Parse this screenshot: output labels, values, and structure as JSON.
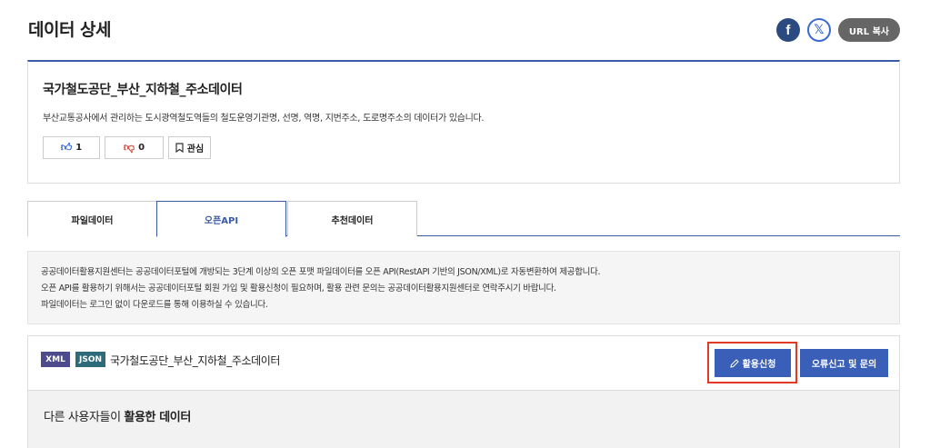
{
  "page": {
    "title": "데이터 상세"
  },
  "share": {
    "facebook_icon": "facebook-icon",
    "x_icon": "x-icon",
    "url_copy_label": "URL 복사"
  },
  "summary": {
    "title": "국가철도공단_부산_지하철_주소데이터",
    "description": "부산교통공사에서 관리하는 도시광역철도역들의 철도운영기관명, 선명, 역명, 지번주소, 도로명주소의 데이터가 있습니다.",
    "like_count": "1",
    "dislike_count": "0",
    "favorite_label": "관심"
  },
  "tabs": [
    {
      "label": "파일데이터",
      "active": false
    },
    {
      "label": "오픈API",
      "active": true
    },
    {
      "label": "추천데이터",
      "active": false
    }
  ],
  "notice": {
    "lines": [
      "공공데이터활용지원센터는 공공데이터포털에 개방되는 3단계 이상의 오픈 포맷 파일데이터를 오픈 API(RestAPI 기반의 JSON/XML)로 자동변환하여 제공합니다.",
      "오픈 API를 활용하기 위해서는 공공데이터포털 회원 가입 및 활용신청이 필요하며, 활용 관련 문의는 공공데이터활용지원센터로 연락주시기 바랍니다.",
      "파일데이터는 로그인 없이 다운로드를 통해 이용하실 수 있습니다."
    ]
  },
  "api": {
    "badges": [
      "XML",
      "JSON"
    ],
    "name": "국가철도공단_부산_지하철_주소데이터",
    "apply_label": "활용신청",
    "report_label": "오류신고 및 문의"
  },
  "others": {
    "heading_prefix": "다른 사용자들이 ",
    "heading_bold": "활용한 데이터"
  },
  "colors": {
    "accent": "#3a5aa5",
    "button": "#3a5fb8",
    "highlight": "#e03b24",
    "xml_badge": "#4d4b8c",
    "json_badge": "#2e6b7a"
  }
}
